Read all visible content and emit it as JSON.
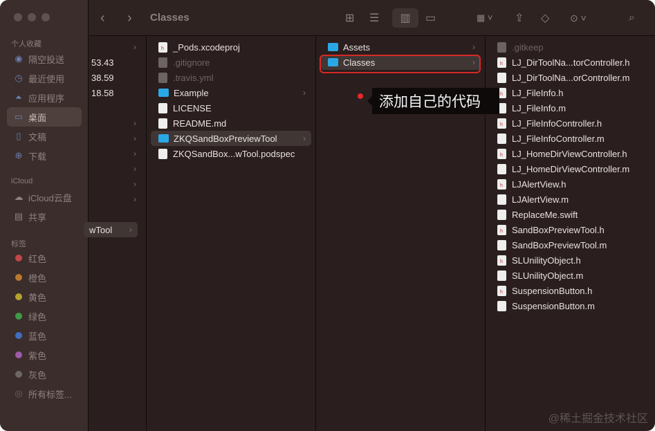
{
  "window": {
    "title": "Classes"
  },
  "sidebar": {
    "favorites_label": "个人收藏",
    "favorites": [
      {
        "label": "隔空投送",
        "icon": "airdrop-icon"
      },
      {
        "label": "最近使用",
        "icon": "clock-icon"
      },
      {
        "label": "应用程序",
        "icon": "applications-icon"
      },
      {
        "label": "桌面",
        "icon": "desktop-icon"
      },
      {
        "label": "文稿",
        "icon": "document-icon"
      },
      {
        "label": "下载",
        "icon": "download-icon"
      }
    ],
    "icloud_label": "iCloud",
    "icloud": [
      {
        "label": "iCloud云盘",
        "icon": "cloud-icon"
      },
      {
        "label": "共享",
        "icon": "shared-folder-icon"
      }
    ],
    "tags_label": "标签",
    "tags": [
      {
        "label": "红色",
        "color": "#c0474a"
      },
      {
        "label": "橙色",
        "color": "#b8792f"
      },
      {
        "label": "黄色",
        "color": "#b5a12e"
      },
      {
        "label": "绿色",
        "color": "#3f9a46"
      },
      {
        "label": "蓝色",
        "color": "#3f6ec0"
      },
      {
        "label": "紫色",
        "color": "#9e5aa8"
      },
      {
        "label": "灰色",
        "color": "#6e6664"
      }
    ],
    "all_tags": "所有标签..."
  },
  "column0": {
    "values": [
      "53.43",
      "38.59",
      "18.58"
    ],
    "selected": "wTool"
  },
  "column1": [
    {
      "name": "_Pods.xcodeproj"
    },
    {
      "name": ".gitignore"
    },
    {
      "name": ".travis.yml"
    },
    {
      "name": "Example"
    },
    {
      "name": "LICENSE"
    },
    {
      "name": "README.md"
    },
    {
      "name": "ZKQSandBoxPreviewTool"
    },
    {
      "name": "ZKQSandBox...wTool.podspec"
    }
  ],
  "column2": [
    {
      "name": "Assets"
    },
    {
      "name": "Classes"
    }
  ],
  "column3": [
    ".gitkeep",
    "LJ_DirToolNa...torController.h",
    "LJ_DirToolNa...orController.m",
    "LJ_FileInfo.h",
    "LJ_FileInfo.m",
    "LJ_FileInfoController.h",
    "LJ_FileInfoController.m",
    "LJ_HomeDirViewController.h",
    "LJ_HomeDirViewController.m",
    "LJAlertView.h",
    "LJAlertView.m",
    "ReplaceMe.swift",
    "SandBoxPreviewTool.h",
    "SandBoxPreviewTool.m",
    "SLUnilityObject.h",
    "SLUnilityObject.m",
    "SuspensionButton.h",
    "SuspensionButton.m"
  ],
  "annotation": {
    "text": "添加自己的代码",
    "color": "#d52a26"
  },
  "watermark": "@稀土掘金技术社区"
}
